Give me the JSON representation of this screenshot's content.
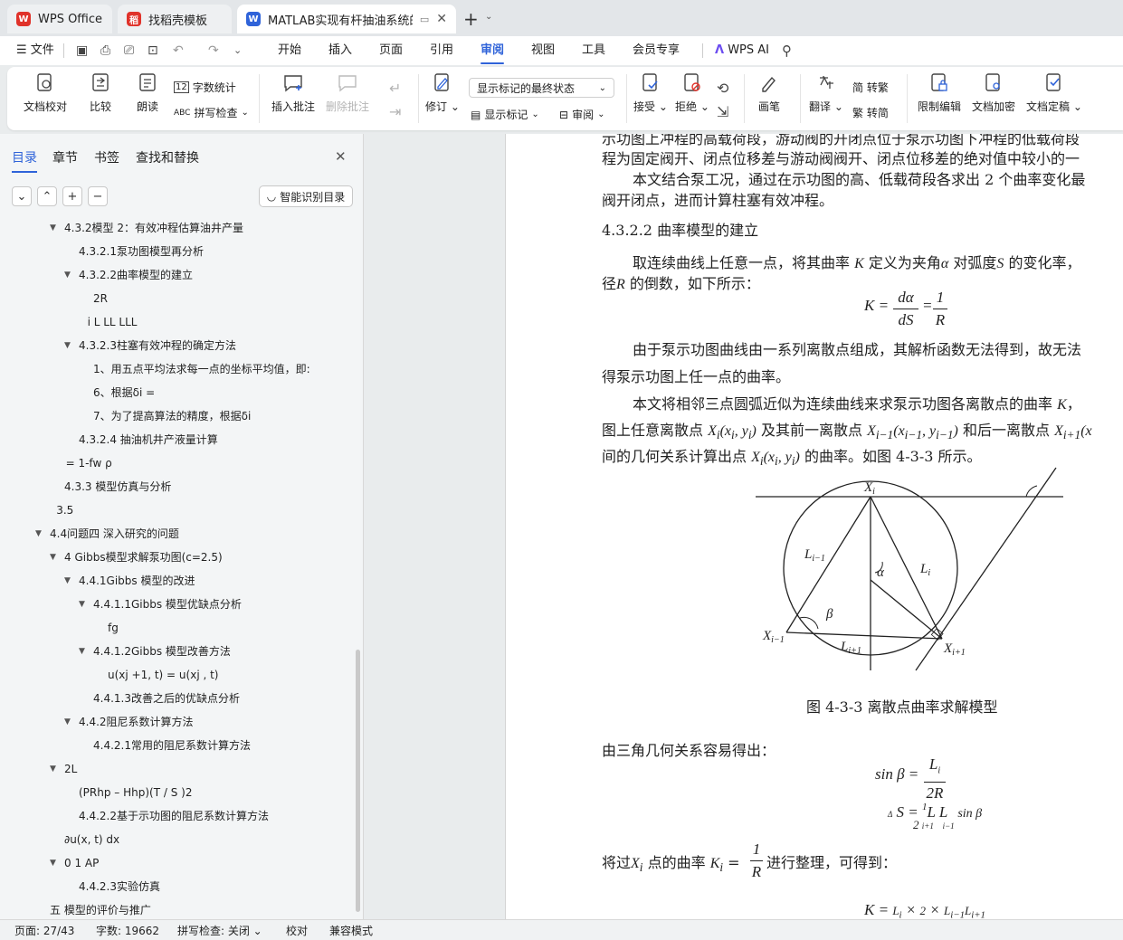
{
  "tabs": [
    {
      "label": "WPS Office"
    },
    {
      "label": "找稻壳模板"
    },
    {
      "label": "MATLAB实现有杆抽油系统的"
    }
  ],
  "menu": {
    "file": "文件",
    "items": [
      "开始",
      "插入",
      "页面",
      "引用",
      "审阅",
      "视图",
      "工具",
      "会员专享"
    ],
    "ai": "WPS AI"
  },
  "ribbon": {
    "doc_check": "文档校对",
    "compare": "比较",
    "read_aloud": "朗读",
    "word_count": "字数统计",
    "spell_check": "拼写检查",
    "insert_comment": "插入批注",
    "delete_comment": "删除批注",
    "revise": "修订",
    "markup_select": "显示标记的最终状态",
    "show_markup": "显示标记",
    "review_pane": "审阅",
    "accept": "接受",
    "reject": "拒绝",
    "pen": "画笔",
    "translate": "翻译",
    "to_traditional": "简 转繁",
    "to_simplified": "繁 转简",
    "restrict_edit": "限制编辑",
    "encrypt": "文档加密",
    "finalize": "文档定稿"
  },
  "panel": {
    "tabs": [
      "目录",
      "章节",
      "书签",
      "查找和替换"
    ],
    "smart_btn": "智能识别目录",
    "toc": [
      {
        "text": "4.3.2模型 2：有效冲程估算油井产量",
        "lvl": 2,
        "tw": 1
      },
      {
        "text": "4.3.2.1泵功图模型再分析",
        "lvl": 3,
        "tw": 0
      },
      {
        "text": "4.3.2.2曲率模型的建立",
        "lvl": 3,
        "tw": 1
      },
      {
        "text": "2R",
        "lvl": 4,
        "tw": 0
      },
      {
        "text": "i L  LL LLL",
        "lvl": 3.6,
        "tw": 0
      },
      {
        "text": "4.3.2.3柱塞有效冲程的确定方法",
        "lvl": 3,
        "tw": 1
      },
      {
        "text": "1、用五点平均法求每一点的坐标平均值，即:",
        "lvl": 4,
        "tw": 0
      },
      {
        "text": "6、根据δi =",
        "lvl": 4,
        "tw": 0
      },
      {
        "text": "7、为了提高算法的精度，根据δi",
        "lvl": 4,
        "tw": 0
      },
      {
        "text": "4.3.2.4 抽油机井产液量计算",
        "lvl": 3,
        "tw": 0
      },
      {
        "text": "= 1-fw ρ",
        "lvl": 2.1,
        "tw": 0
      },
      {
        "text": "4.3.3 模型仿真与分析",
        "lvl": 2,
        "tw": 0
      },
      {
        "text": "3.5",
        "lvl": 1.45,
        "tw": 0
      },
      {
        "text": "4.4问题四 深入研究的问题",
        "lvl": 1,
        "tw": 1
      },
      {
        "text": "4 Gibbs模型求解泵功图(c=2.5)",
        "lvl": 2,
        "tw": 1
      },
      {
        "text": "4.4.1Gibbs 模型的改进",
        "lvl": 3,
        "tw": 1
      },
      {
        "text": "4.4.1.1Gibbs 模型优缺点分析",
        "lvl": 4,
        "tw": 1
      },
      {
        "text": "fg",
        "lvl": 5,
        "tw": 0
      },
      {
        "text": "4.4.1.2Gibbs 模型改善方法",
        "lvl": 4,
        "tw": 1
      },
      {
        "text": "u(xj +1, t) = u(xj , t)",
        "lvl": 5,
        "tw": 0
      },
      {
        "text": "4.4.1.3改善之后的优缺点分析",
        "lvl": 4,
        "tw": 0
      },
      {
        "text": "4.4.2阻尼系数计算方法",
        "lvl": 3,
        "tw": 1
      },
      {
        "text": "4.4.2.1常用的阻尼系数计算方法",
        "lvl": 4,
        "tw": 0
      },
      {
        "text": "2L",
        "lvl": 2,
        "tw": 1
      },
      {
        "text": "(PRhp – Hhp)(T / S )2",
        "lvl": 3,
        "tw": 0
      },
      {
        "text": "4.4.2.2基于示功图的阻尼系数计算方法",
        "lvl": 3,
        "tw": 0
      },
      {
        "text": "∂u(x, t) dx",
        "lvl": 2,
        "tw": 0
      },
      {
        "text": "0 1  AP",
        "lvl": 2,
        "tw": 1
      },
      {
        "text": "4.4.2.3实验仿真",
        "lvl": 3,
        "tw": 0
      },
      {
        "text": "五 模型的评价与推广",
        "lvl": 1,
        "tw": 0
      }
    ]
  },
  "doc": {
    "line0": "示功图上冲程的高载荷段，游动阀的开闭点位于泵示功图下冲程的低载荷段",
    "line1": "程为固定阀开、闭点位移差与游动阀阀开、闭点位移差的绝对值中较小的一",
    "line2": "本文结合泵工况，通过在示功图的高、低载荷段各求出 2 个曲率变化最",
    "line3": "阀开闭点，进而计算柱塞有效冲程。",
    "heading": "4.3.2.2 曲率模型的建立",
    "p1a": "取连续曲线上任意一点，将其曲率",
    "p1b": "定义为夹角",
    "p1c": "对弧度",
    "p1d": "的变化率，",
    "p1e": "径",
    "p1f": "的倒数，如下所示：",
    "p2a": "由于泵示功图曲线由一系列离散点组成，其解析函数无法得到，故无法",
    "p2b": "得泵示功图上任一点的曲率。",
    "p3a": "本文将相邻三点圆弧近似为连续曲线来求泵示功图各离散点的曲率",
    "p3b": "图上任意离散点",
    "p3c": "及其前一离散点",
    "p3d": "和后一离散点",
    "p3e": "间的几何关系计算出点",
    "p3f": "的曲率。如图 4-3-3 所示。",
    "caption": "图 4-3-3 离散点曲率求解模型",
    "p4": "由三角几何关系容易得出：",
    "p5a": "将过",
    "p5b": "点的曲率",
    "p5c": "进行整理，可得到："
  },
  "status": {
    "page": "页面: 27/43",
    "words": "字数: 19662",
    "spell": "拼写检查: 关闭",
    "proof": "校对",
    "compat": "兼容模式"
  },
  "colors": {
    "accent": "#2f63d9",
    "wps_red": "#e0322a",
    "doc_blue": "#2f63d9",
    "tab_bg": "#e3e6e9"
  }
}
